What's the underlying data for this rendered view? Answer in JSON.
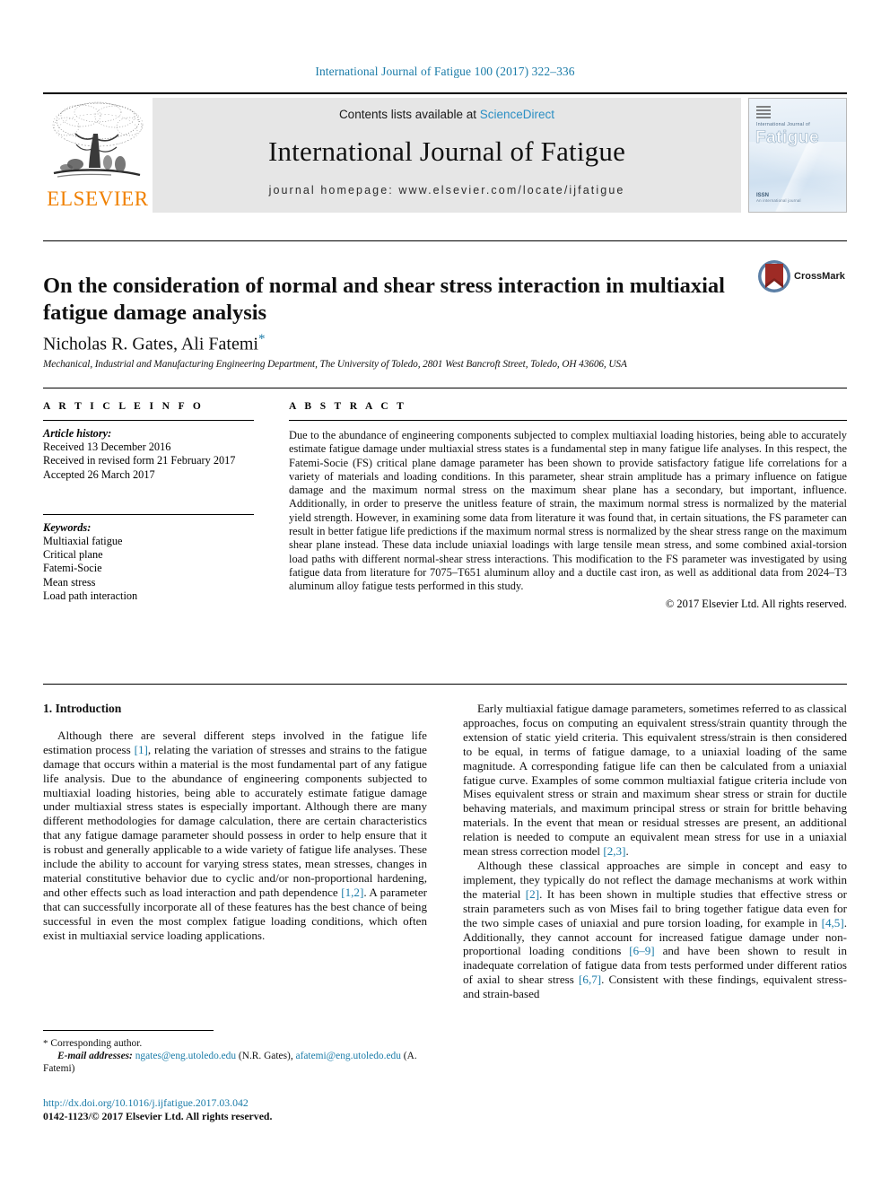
{
  "running_head": "International Journal of Fatigue 100 (2017) 322–336",
  "masthead": {
    "publisher_name": "ELSEVIER",
    "publisher_logo": "elsevier-tree-logo",
    "contents_prefix": "Contents lists available at ",
    "contents_link": "ScienceDirect",
    "journal_name": "International Journal of Fatigue",
    "homepage": "journal homepage: www.elsevier.com/locate/ijfatigue",
    "cover": {
      "superline": "International Journal of",
      "title": "Fatigue",
      "issn": "ISSN",
      "issn_sub": "An international journal"
    }
  },
  "article": {
    "title": "On the consideration of normal and shear stress interaction in multiaxial fatigue damage analysis",
    "authors": "Nicholas R. Gates, Ali Fatemi",
    "corresponding_marker": "*",
    "affiliation": "Mechanical, Industrial and Manufacturing Engineering Department, The University of Toledo, 2801 West Bancroft Street, Toledo, OH 43606, USA",
    "crossmark_label": "CrossMark"
  },
  "info": {
    "heading": "A R T I C L E    I N F O",
    "history_label": "Article history:",
    "history": [
      "Received 13 December 2016",
      "Received in revised form 21 February 2017",
      "Accepted 26 March 2017"
    ],
    "keywords_label": "Keywords:",
    "keywords": [
      "Multiaxial fatigue",
      "Critical plane",
      "Fatemi-Socie",
      "Mean stress",
      "Load path interaction"
    ]
  },
  "abstract": {
    "heading": "A B S T R A C T",
    "text": "Due to the abundance of engineering components subjected to complex multiaxial loading histories, being able to accurately estimate fatigue damage under multiaxial stress states is a fundamental step in many fatigue life analyses. In this respect, the Fatemi-Socie (FS) critical plane damage parameter has been shown to provide satisfactory fatigue life correlations for a variety of materials and loading conditions. In this parameter, shear strain amplitude has a primary influence on fatigue damage and the maximum normal stress on the maximum shear plane has a secondary, but important, influence. Additionally, in order to preserve the unitless feature of strain, the maximum normal stress is normalized by the material yield strength. However, in examining some data from literature it was found that, in certain situations, the FS parameter can result in better fatigue life predictions if the maximum normal stress is normalized by the shear stress range on the maximum shear plane instead. These data include uniaxial loadings with large tensile mean stress, and some combined axial-torsion load paths with different normal-shear stress interactions. This modification to the FS parameter was investigated by using fatigue data from literature for 7075–T651 aluminum alloy and a ductile cast iron, as well as additional data from 2024–T3 aluminum alloy fatigue tests performed in this study.",
    "copyright": "© 2017 Elsevier Ltd. All rights reserved."
  },
  "body": {
    "section_heading": "1. Introduction",
    "left_paragraphs": [
      {
        "segments": [
          {
            "t": "Although there are several different steps involved in the fatigue life estimation process "
          },
          {
            "t": "[1]",
            "ref": true
          },
          {
            "t": ", relating the variation of stresses and strains to the fatigue damage that occurs within a material is the most fundamental part of any fatigue life analysis. Due to the abundance of engineering components subjected to multiaxial loading histories, being able to accurately estimate fatigue damage under multiaxial stress states is especially important. Although there are many different methodologies for damage calculation, there are certain characteristics that any fatigue damage parameter should possess in order to help ensure that it is robust and generally applicable to a wide variety of fatigue life analyses. These include the ability to account for varying stress states, mean stresses, changes in material constitutive behavior due to cyclic and/or non-proportional hardening, and other effects such as load interaction and path dependence "
          },
          {
            "t": "[1,2]",
            "ref": true
          },
          {
            "t": ". A parameter that can successfully incorporate all of these features has the best chance of being successful in even the most complex fatigue loading conditions, which often exist in multiaxial service loading applications."
          }
        ]
      }
    ],
    "right_paragraphs": [
      {
        "segments": [
          {
            "t": "Early multiaxial fatigue damage parameters, sometimes referred to as classical approaches, focus on computing an equivalent stress/strain quantity through the extension of static yield criteria. This equivalent stress/strain is then considered to be equal, in terms of fatigue damage, to a uniaxial loading of the same magnitude. A corresponding fatigue life can then be calculated from a uniaxial fatigue curve. Examples of some common multiaxial fatigue criteria include von Mises equivalent stress or strain and maximum shear stress or strain for ductile behaving materials, and maximum principal stress or strain for brittle behaving materials. In the event that mean or residual stresses are present, an additional relation is needed to compute an equivalent mean stress for use in a uniaxial mean stress correction model "
          },
          {
            "t": "[2,3]",
            "ref": true
          },
          {
            "t": "."
          }
        ]
      },
      {
        "segments": [
          {
            "t": "Although these classical approaches are simple in concept and easy to implement, they typically do not reflect the damage mechanisms at work within the material "
          },
          {
            "t": "[2]",
            "ref": true
          },
          {
            "t": ". It has been shown in multiple studies that effective stress or strain parameters such as von Mises fail to bring together fatigue data even for the two simple cases of uniaxial and pure torsion loading, for example in "
          },
          {
            "t": "[4,5]",
            "ref": true
          },
          {
            "t": ". Additionally, they cannot account for increased fatigue damage under non-proportional loading conditions "
          },
          {
            "t": "[6–9]",
            "ref": true
          },
          {
            "t": " and have been shown to result in inadequate correlation of fatigue data from tests performed under different ratios of axial to shear stress "
          },
          {
            "t": "[6,7]",
            "ref": true
          },
          {
            "t": ". Consistent with these findings, equivalent stress- and strain-based"
          }
        ]
      }
    ]
  },
  "footer": {
    "corresponding_marker": "*",
    "corresponding_label": "Corresponding author.",
    "email_label": "E-mail addresses:",
    "emails": [
      {
        "address": "ngates@eng.utoledo.edu",
        "owner": "(N.R. Gates)"
      },
      {
        "address": "afatemi@eng.utoledo.edu",
        "owner": "(A. Fatemi)"
      }
    ],
    "doi": "http://dx.doi.org/10.1016/j.ijfatigue.2017.03.042",
    "issn_line": "0142-1123/© 2017 Elsevier Ltd. All rights reserved."
  },
  "colors": {
    "link": "#1a7ba8",
    "elsevier_orange": "#f08000",
    "band_grey": "#e6e6e6",
    "crossmark_red": "#9e2b25"
  }
}
